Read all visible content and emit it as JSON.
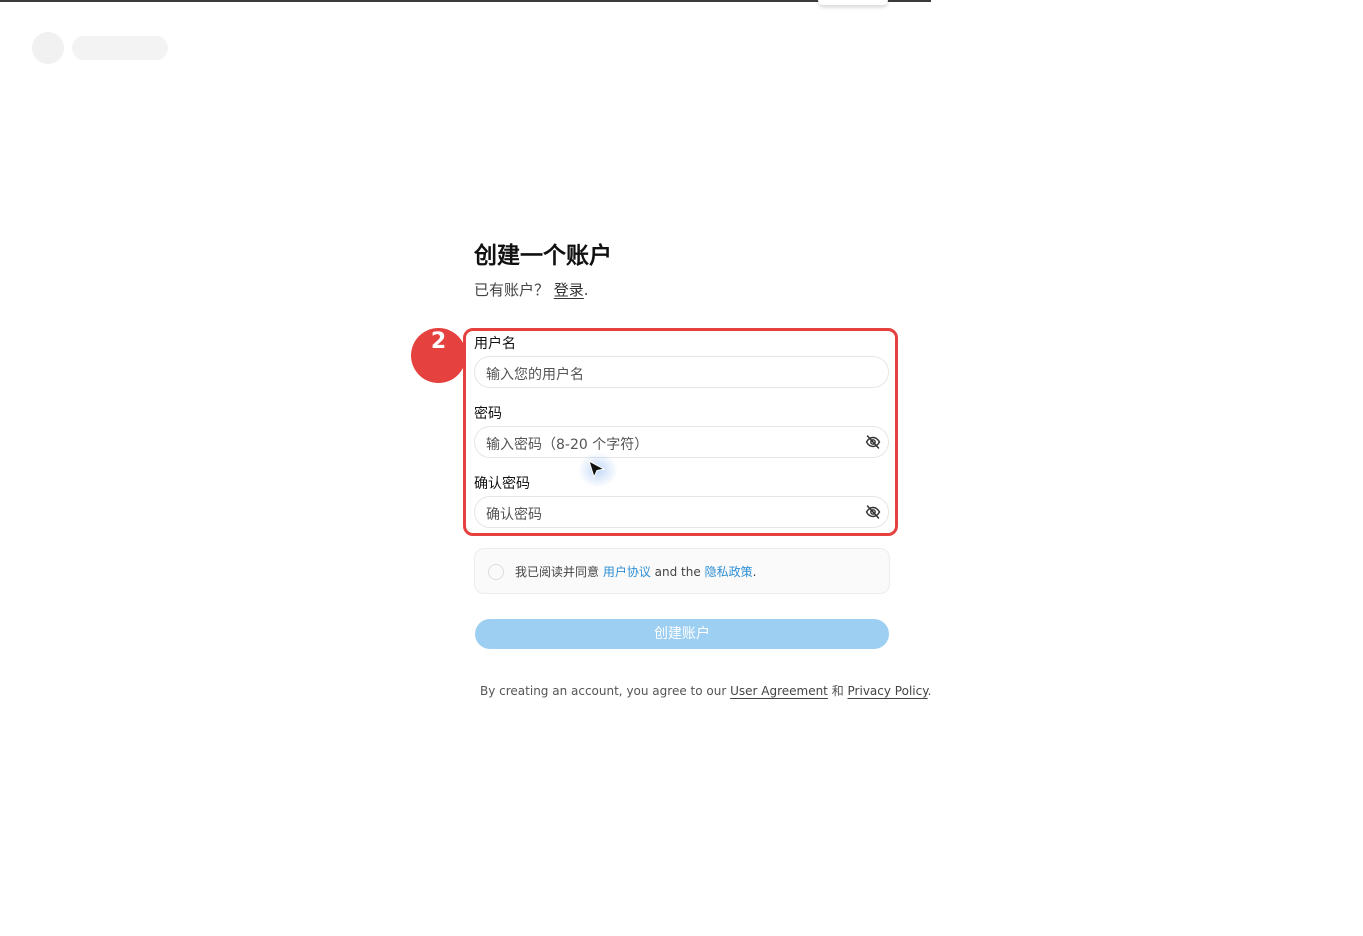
{
  "header": {
    "logo_placeholder": ""
  },
  "form": {
    "title": "创建一个账户",
    "subtitle_prefix": "已有账户？ ",
    "login_link": "登录",
    "subtitle_suffix": ".",
    "username": {
      "label": "用户名",
      "placeholder": "输入您的用户名",
      "value": ""
    },
    "password": {
      "label": "密码",
      "placeholder": "输入密码（8-20 个字符）",
      "value": "",
      "toggle_icon": "eye-off-icon"
    },
    "confirm_password": {
      "label": "确认密码",
      "placeholder": "确认密码",
      "value": "",
      "toggle_icon": "eye-off-icon"
    },
    "agreement": {
      "checked": false,
      "prefix": "我已阅读并同意 ",
      "user_agreement": "用户协议",
      "middle": " and the ",
      "privacy_policy": "隐私政策",
      "suffix": "."
    },
    "submit_label": "创建账户",
    "terms": {
      "prefix": "By creating an account, you agree to our ",
      "user_agreement": "User Agreement",
      "middle": " 和 ",
      "privacy_policy": "Privacy Policy",
      "suffix": "."
    }
  },
  "annotation": {
    "step_number": "2"
  },
  "colors": {
    "accent_blue": "#2e8fd6",
    "button_disabled": "#9dcff2",
    "annotation_red": "#e5413f"
  }
}
